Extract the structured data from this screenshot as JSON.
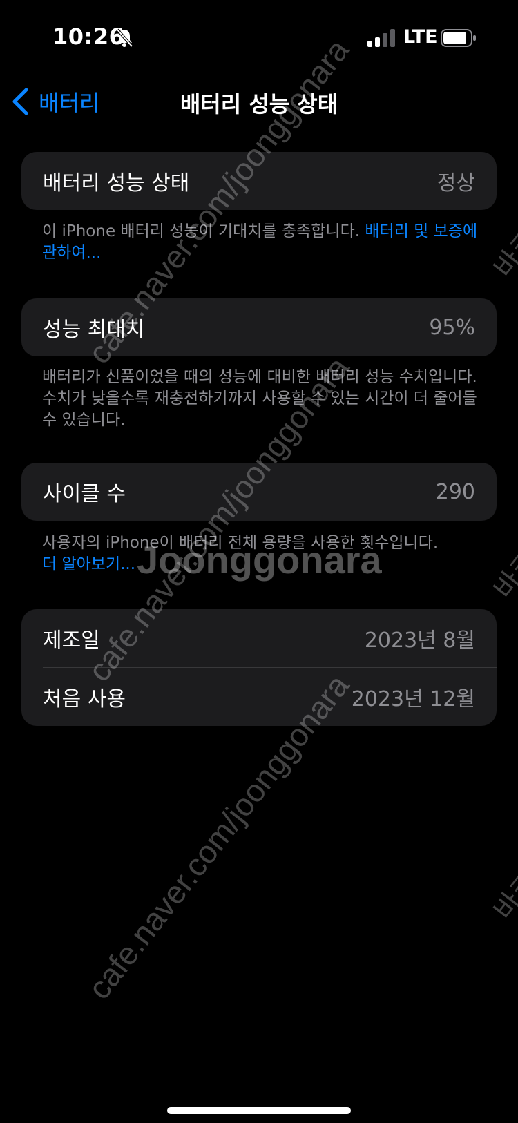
{
  "status_bar": {
    "time": "10:26",
    "network": "LTE",
    "icons": [
      "bell-slash-icon",
      "signal-icon",
      "battery-icon"
    ]
  },
  "nav": {
    "back_label": "배터리",
    "title": "배터리 성능 상태"
  },
  "battery_health": {
    "label": "배터리 성능 상태",
    "value": "정상",
    "footnote": "이 iPhone 배터리 성능이 기대치를 충족합니다. ",
    "link": "배터리 및 보증에 관하여..."
  },
  "max_capacity": {
    "label": "성능 최대치",
    "value": "95%",
    "footnote": "배터리가 신품이었을 때의 성능에 대비한 배터리 성능 수치입니다. 수치가 낮을수록 재충전하기까지 사용할 수 있는 시간이 더 줄어들 수 있습니다."
  },
  "cycle_count": {
    "label": "사이클 수",
    "value": "290",
    "footnote": "사용자의 iPhone이 배터리 전체 용량을 사용한 횟수입니다.",
    "link": "더 알아보기..."
  },
  "dates": [
    {
      "label": "제조일",
      "value": "2023년 8월"
    },
    {
      "label": "처음 사용",
      "value": "2023년 12월"
    }
  ],
  "watermark": {
    "diagonal_text": "cafe.naver.com/joonggonara",
    "logo_text": "Joonggonara",
    "side_text": "바코"
  },
  "colors": {
    "background": "#000000",
    "cell": "#1c1c1e",
    "accent": "#0a84ff",
    "secondary_text": "#8e8e93"
  }
}
